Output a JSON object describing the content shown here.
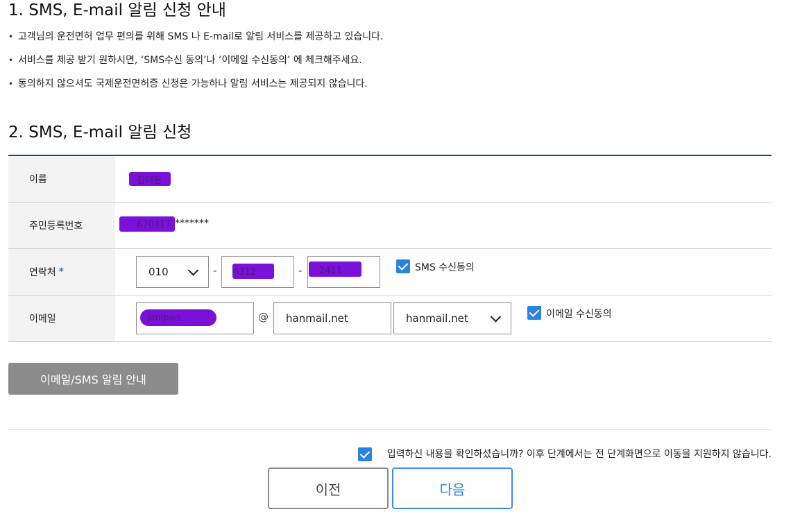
{
  "section1": {
    "title": "1. SMS, E-mail 알림 신청 안내",
    "bullets": [
      "고객님의 운전면허 업무 편의를 위해 SMS 나 E-mail로 알림 서비스를 제공하고 있습니다.",
      "서비스를 제공 받기 원하시면, ‘SMS수신 동의’나 ‘이메일 수신동의’ 에 체크해주세요.",
      "동의하지 않으셔도 국제운전면허증 신청은 가능하나 알림 서비스는 제공되지 않습니다."
    ]
  },
  "section2": {
    "title": "2. SMS, E-mail 알림 신청"
  },
  "form": {
    "name": {
      "label": "이름",
      "value": "김태원"
    },
    "rrn": {
      "label": "주민등록번호",
      "value_front": "670417",
      "value_masked": "*******"
    },
    "phone": {
      "label": "연락처",
      "required_mark": "*",
      "prefix": "010",
      "sep": "-",
      "middle": "6312",
      "last": "2411",
      "consent_label": "SMS 수신동의",
      "consent_checked": true
    },
    "email": {
      "label": "이메일",
      "local": "jimipan",
      "at": "@",
      "domain": "hanmail.net",
      "domain_select": "hanmail.net",
      "consent_label": "이메일 수신동의",
      "consent_checked": true
    }
  },
  "notice_button": "이메일/SMS 알림 안내",
  "confirm": {
    "text": "입력하신 내용을 확인하셨습니까? 이후 단계에서는 전 단계화면으로 이동을 지원하지 않습니다.",
    "checked": true
  },
  "buttons": {
    "prev": "이전",
    "next": "다음"
  },
  "colors": {
    "accent": "#2a83e0",
    "table_border": "#1a4a8a",
    "redaction": "#7b11d8"
  }
}
